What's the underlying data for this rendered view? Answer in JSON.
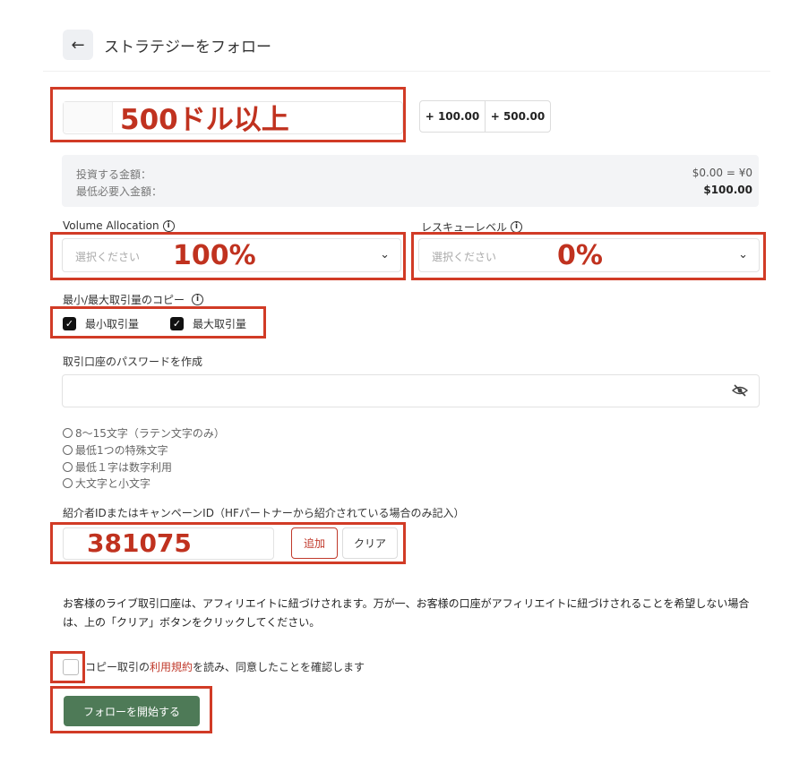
{
  "header": {
    "title": "ストラテジーをフォロー",
    "back_icon": "←"
  },
  "amount": {
    "quick_buttons": [
      "+ 100.00",
      "+ 500.00"
    ],
    "annotation": "500ドル以上"
  },
  "summary": {
    "invest_label": "投資する金額：",
    "min_label": "最低必要入金額：",
    "invest_value": "$0.00 = ¥0",
    "min_value": "$100.00"
  },
  "volume_allocation": {
    "label": "Volume Allocation",
    "placeholder": "選択ください",
    "annotation": "100%"
  },
  "rescue_level": {
    "label": "レスキューレベル",
    "placeholder": "選択ください",
    "annotation": "0%"
  },
  "copy_lot": {
    "label": "最小/最大取引量のコピー",
    "min_label": "最小取引量",
    "max_label": "最大取引量"
  },
  "password": {
    "label": "取引口座のパスワードを作成",
    "rules": [
      "8〜15文字（ラテン文字のみ）",
      "最低1つの特殊文字",
      "最低１字は数字利用",
      "大文字と小文字"
    ]
  },
  "referral": {
    "label": "紹介者IDまたはキャンペーンID（HFパートナーから紹介されている場合のみ記入）",
    "annotation": "381075",
    "add_label": "追加",
    "clear_label": "クリア"
  },
  "notice": "お客様のライブ取引口座は、アフィリエイトに紐づけされます。万が一、お客様の口座がアフィリエイトに紐づけされることを希望しない場合は、上の「クリア」ボタンをクリックしてください。",
  "terms": {
    "prefix": "コピー取引の",
    "link": "利用規約",
    "suffix": "を読み、同意したことを確認します"
  },
  "follow_button": "フォローを開始する",
  "colors": {
    "accent_red": "#c0392b",
    "follow_green": "#4e7a57",
    "annotation_red": "#d13b26"
  }
}
